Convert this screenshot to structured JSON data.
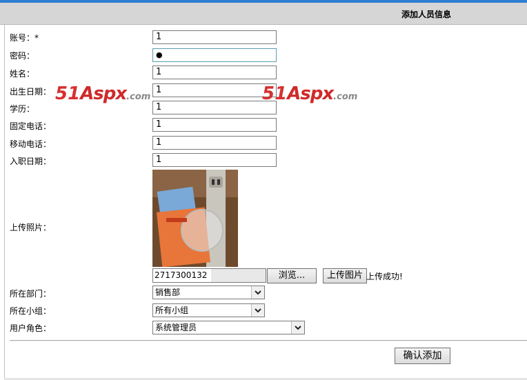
{
  "header": {
    "title": "添加人员信息"
  },
  "form": {
    "account": {
      "label": "账号：*",
      "value": "1"
    },
    "password": {
      "label": "密码：",
      "value": "●"
    },
    "name": {
      "label": "姓名：",
      "value": "1"
    },
    "birthdate": {
      "label": "出生日期：",
      "value": "1"
    },
    "education": {
      "label": "学历：",
      "value": "1"
    },
    "landline": {
      "label": "固定电话：",
      "value": "1"
    },
    "mobile": {
      "label": "移动电话：",
      "value": "1"
    },
    "hire_date": {
      "label": "入职日期：",
      "value": "1"
    },
    "photo": {
      "label": "上传照片：",
      "file_name": "2717300132",
      "browse_label": "浏览...",
      "upload_label": "上传图片",
      "upload_status": "上传成功!"
    },
    "department": {
      "label": "所在部门：",
      "selected": "销售部"
    },
    "group": {
      "label": "所在小组：",
      "selected": "所有小组"
    },
    "role": {
      "label": "用户角色：",
      "selected": "系统管理员"
    },
    "submit_label": "确认添加"
  },
  "watermark": {
    "num": "51",
    "aspx": "Aspx",
    "domain": ".com"
  },
  "colors": {
    "header_bg": "#d6d6d6",
    "top_bar": "#2f7fd3",
    "watermark_red": "#d63131"
  }
}
